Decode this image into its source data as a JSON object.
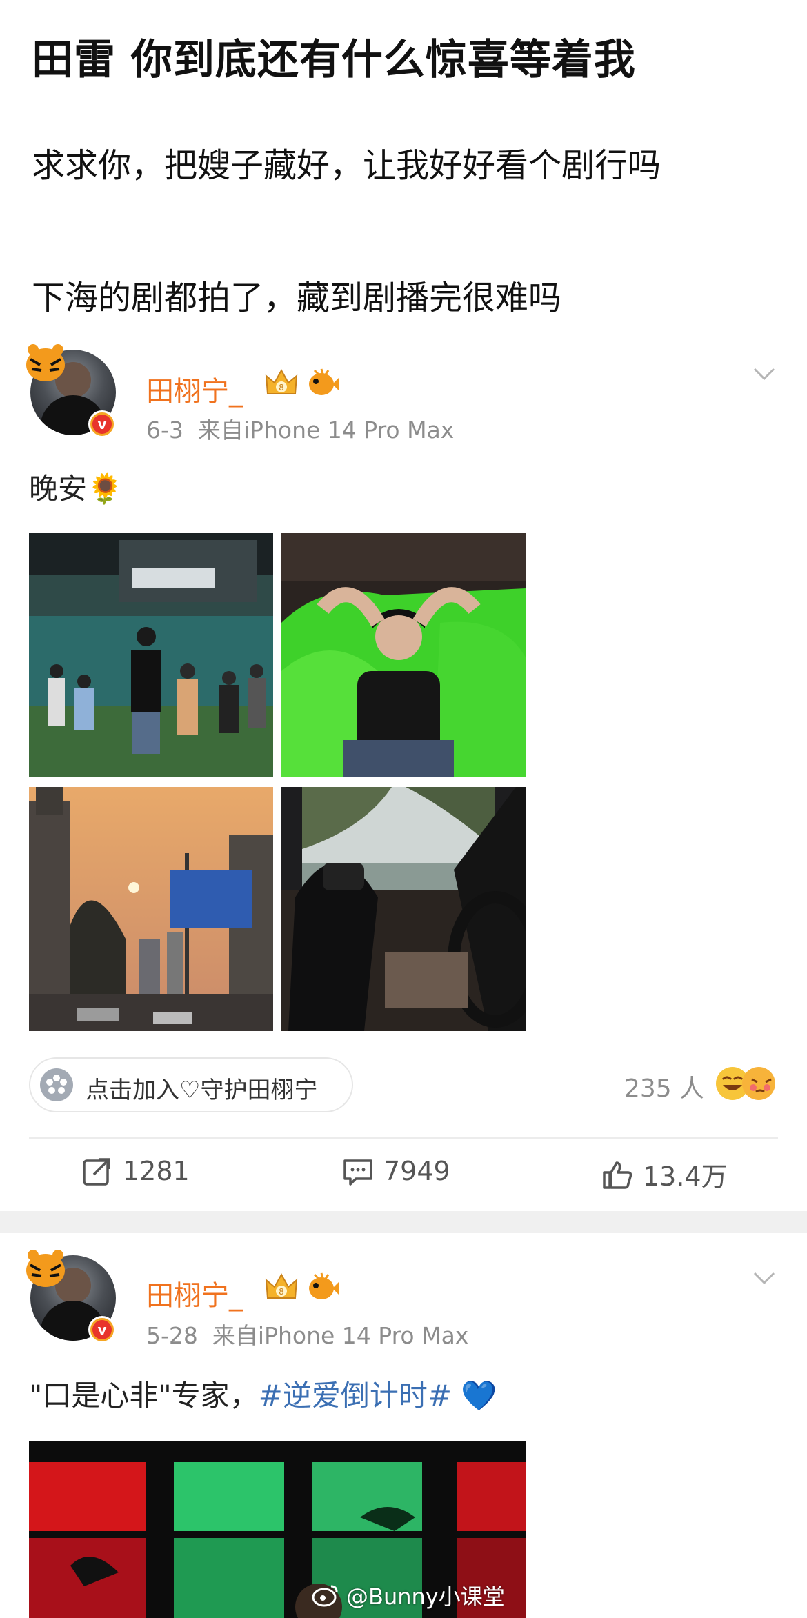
{
  "headline": {
    "title": "田雷 你到底还有什么惊喜等着我",
    "line1": "求求你，把嫂子藏好，让我好好看个剧行吗",
    "line2": "下海的剧都拍了，藏到剧播完很难吗"
  },
  "posts": [
    {
      "username": "田栩宁_",
      "date": "6-3",
      "source": "来自iPhone 14 Pro Max",
      "text": "晚安🌻",
      "images": [
        "concert-crowd-photo",
        "green-beanbag-photo",
        "sunset-road-photo",
        "car-interior-photo"
      ],
      "join_label": "点击加入♡守护田栩宁",
      "supporter_count": "235 人",
      "actions": {
        "repost": "1281",
        "comment": "7949",
        "like": "13.4万"
      }
    },
    {
      "username": "田栩宁_",
      "date": "5-28",
      "source": "来自iPhone 14 Pro Max",
      "text_plain": "\"口是心非\"专家，",
      "text_tag": "#逆爱倒计时#",
      "text_emoji": "💙",
      "images": [
        "neon-red-green-photo"
      ]
    }
  ],
  "watermark": "@Bunny小课堂"
}
